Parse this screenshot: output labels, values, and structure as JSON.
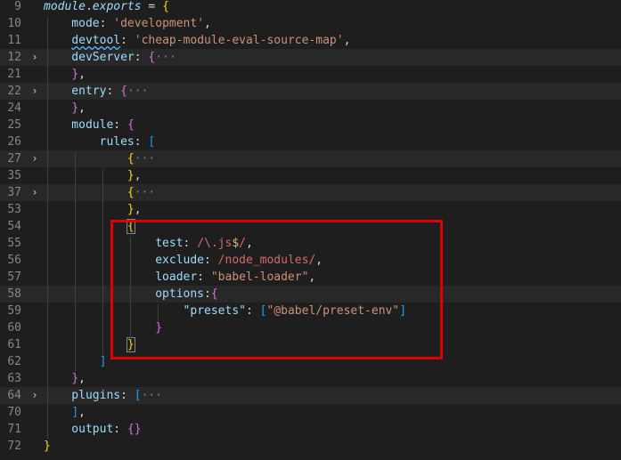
{
  "editor": {
    "lines": [
      {
        "num": "9",
        "fold": "",
        "tokens": [
          {
            "t": "module",
            "c": "tok-italic"
          },
          {
            "t": ".",
            "c": "tok-punc"
          },
          {
            "t": "exports",
            "c": "tok-italic"
          },
          {
            "t": " = ",
            "c": "tok-punc"
          },
          {
            "t": "{",
            "c": "tok-brace"
          }
        ]
      },
      {
        "num": "10",
        "fold": "",
        "tokens": [
          {
            "t": "    mode",
            "c": "tok-var"
          },
          {
            "t": ": ",
            "c": "tok-punc"
          },
          {
            "t": "'development'",
            "c": "tok-str"
          },
          {
            "t": ",",
            "c": "tok-punc"
          }
        ]
      },
      {
        "num": "11",
        "fold": "",
        "tokens": [
          {
            "t": "    ",
            "c": "tok-punc"
          },
          {
            "t": "devtool",
            "c": "tok-var squiggle"
          },
          {
            "t": ": ",
            "c": "tok-punc"
          },
          {
            "t": "'cheap-module-eval-source-map'",
            "c": "tok-str"
          },
          {
            "t": ",",
            "c": "tok-punc"
          }
        ]
      },
      {
        "num": "12",
        "fold": "›",
        "hl": true,
        "tokens": [
          {
            "t": "    devServer",
            "c": "tok-var"
          },
          {
            "t": ": ",
            "c": "tok-punc"
          },
          {
            "t": "{",
            "c": "tok-brace2"
          },
          {
            "t": "···",
            "c": "tok-ellipsis"
          }
        ]
      },
      {
        "num": "21",
        "fold": "",
        "tokens": [
          {
            "t": "    ",
            "c": "tok-punc"
          },
          {
            "t": "}",
            "c": "tok-brace2"
          },
          {
            "t": ",",
            "c": "tok-punc"
          }
        ]
      },
      {
        "num": "22",
        "fold": "›",
        "hl": true,
        "tokens": [
          {
            "t": "    entry",
            "c": "tok-var"
          },
          {
            "t": ": ",
            "c": "tok-punc"
          },
          {
            "t": "{",
            "c": "tok-brace2"
          },
          {
            "t": "···",
            "c": "tok-ellipsis"
          }
        ]
      },
      {
        "num": "24",
        "fold": "",
        "tokens": [
          {
            "t": "    ",
            "c": "tok-punc"
          },
          {
            "t": "}",
            "c": "tok-brace2"
          },
          {
            "t": ",",
            "c": "tok-punc"
          }
        ]
      },
      {
        "num": "25",
        "fold": "",
        "tokens": [
          {
            "t": "    module",
            "c": "tok-var"
          },
          {
            "t": ": ",
            "c": "tok-punc"
          },
          {
            "t": "{",
            "c": "tok-brace2"
          }
        ]
      },
      {
        "num": "26",
        "fold": "",
        "tokens": [
          {
            "t": "        rules",
            "c": "tok-var"
          },
          {
            "t": ": ",
            "c": "tok-punc"
          },
          {
            "t": "[",
            "c": "tok-brack"
          }
        ]
      },
      {
        "num": "27",
        "fold": "›",
        "hl": true,
        "tokens": [
          {
            "t": "            ",
            "c": "tok-punc"
          },
          {
            "t": "{",
            "c": "tok-brace"
          },
          {
            "t": "···",
            "c": "tok-ellipsis"
          }
        ]
      },
      {
        "num": "35",
        "fold": "",
        "tokens": [
          {
            "t": "            ",
            "c": "tok-punc"
          },
          {
            "t": "}",
            "c": "tok-brace"
          },
          {
            "t": ",",
            "c": "tok-punc"
          }
        ]
      },
      {
        "num": "37",
        "fold": "›",
        "hl": true,
        "tokens": [
          {
            "t": "            ",
            "c": "tok-punc"
          },
          {
            "t": "{",
            "c": "tok-brace"
          },
          {
            "t": "···",
            "c": "tok-ellipsis"
          }
        ]
      },
      {
        "num": "53",
        "fold": "",
        "tokens": [
          {
            "t": "            ",
            "c": "tok-punc"
          },
          {
            "t": "}",
            "c": "tok-brace"
          },
          {
            "t": ",",
            "c": "tok-punc"
          }
        ]
      },
      {
        "num": "54",
        "fold": "",
        "tokens": [
          {
            "t": "            ",
            "c": "tok-punc"
          },
          {
            "t": "{",
            "c": "tok-brace bracket-box"
          }
        ]
      },
      {
        "num": "55",
        "fold": "",
        "tokens": [
          {
            "t": "                test",
            "c": "tok-var"
          },
          {
            "t": ": ",
            "c": "tok-punc"
          },
          {
            "t": "/\\.js",
            "c": "tok-regex"
          },
          {
            "t": "$",
            "c": "tok-regex-esc"
          },
          {
            "t": "/",
            "c": "tok-regex"
          },
          {
            "t": ",",
            "c": "tok-punc"
          }
        ]
      },
      {
        "num": "56",
        "fold": "",
        "tokens": [
          {
            "t": "                exclude",
            "c": "tok-var"
          },
          {
            "t": ": ",
            "c": "tok-punc"
          },
          {
            "t": "/node_modules/",
            "c": "tok-regex"
          },
          {
            "t": ",",
            "c": "tok-punc"
          }
        ]
      },
      {
        "num": "57",
        "fold": "",
        "tokens": [
          {
            "t": "                loader",
            "c": "tok-var"
          },
          {
            "t": ": ",
            "c": "tok-punc"
          },
          {
            "t": "\"babel-loader\"",
            "c": "tok-str"
          },
          {
            "t": ",",
            "c": "tok-punc"
          }
        ]
      },
      {
        "num": "58",
        "fold": "",
        "hl": true,
        "tokens": [
          {
            "t": "                options",
            "c": "tok-var"
          },
          {
            "t": ":",
            "c": "tok-punc"
          },
          {
            "t": "{",
            "c": "tok-brace2"
          }
        ]
      },
      {
        "num": "59",
        "fold": "",
        "tokens": [
          {
            "t": "                    ",
            "c": "tok-punc"
          },
          {
            "t": "\"presets\"",
            "c": "tok-var"
          },
          {
            "t": ": ",
            "c": "tok-punc"
          },
          {
            "t": "[",
            "c": "tok-brack"
          },
          {
            "t": "\"@babel/preset-env\"",
            "c": "tok-str"
          },
          {
            "t": "]",
            "c": "tok-brack"
          }
        ]
      },
      {
        "num": "60",
        "fold": "",
        "tokens": [
          {
            "t": "                ",
            "c": "tok-punc"
          },
          {
            "t": "}",
            "c": "tok-brace2"
          }
        ]
      },
      {
        "num": "61",
        "fold": "",
        "tokens": [
          {
            "t": "            ",
            "c": "tok-punc"
          },
          {
            "t": "}",
            "c": "tok-brace bracket-box"
          }
        ]
      },
      {
        "num": "62",
        "fold": "",
        "tokens": [
          {
            "t": "        ",
            "c": "tok-punc"
          },
          {
            "t": "]",
            "c": "tok-brack"
          }
        ]
      },
      {
        "num": "63",
        "fold": "",
        "tokens": [
          {
            "t": "    ",
            "c": "tok-punc"
          },
          {
            "t": "}",
            "c": "tok-brace2"
          },
          {
            "t": ",",
            "c": "tok-punc"
          }
        ]
      },
      {
        "num": "64",
        "fold": "›",
        "hl": true,
        "tokens": [
          {
            "t": "    plugins",
            "c": "tok-var"
          },
          {
            "t": ": ",
            "c": "tok-punc"
          },
          {
            "t": "[",
            "c": "tok-brack"
          },
          {
            "t": "···",
            "c": "tok-ellipsis"
          }
        ]
      },
      {
        "num": "70",
        "fold": "",
        "tokens": [
          {
            "t": "    ",
            "c": "tok-punc"
          },
          {
            "t": "]",
            "c": "tok-brack"
          },
          {
            "t": ",",
            "c": "tok-punc"
          }
        ]
      },
      {
        "num": "71",
        "fold": "",
        "tokens": [
          {
            "t": "    output",
            "c": "tok-var"
          },
          {
            "t": ": ",
            "c": "tok-punc"
          },
          {
            "t": "{}",
            "c": "tok-brace2"
          }
        ]
      },
      {
        "num": "72",
        "fold": "",
        "tokens": [
          {
            "t": "}",
            "c": "tok-brace"
          }
        ]
      }
    ]
  }
}
